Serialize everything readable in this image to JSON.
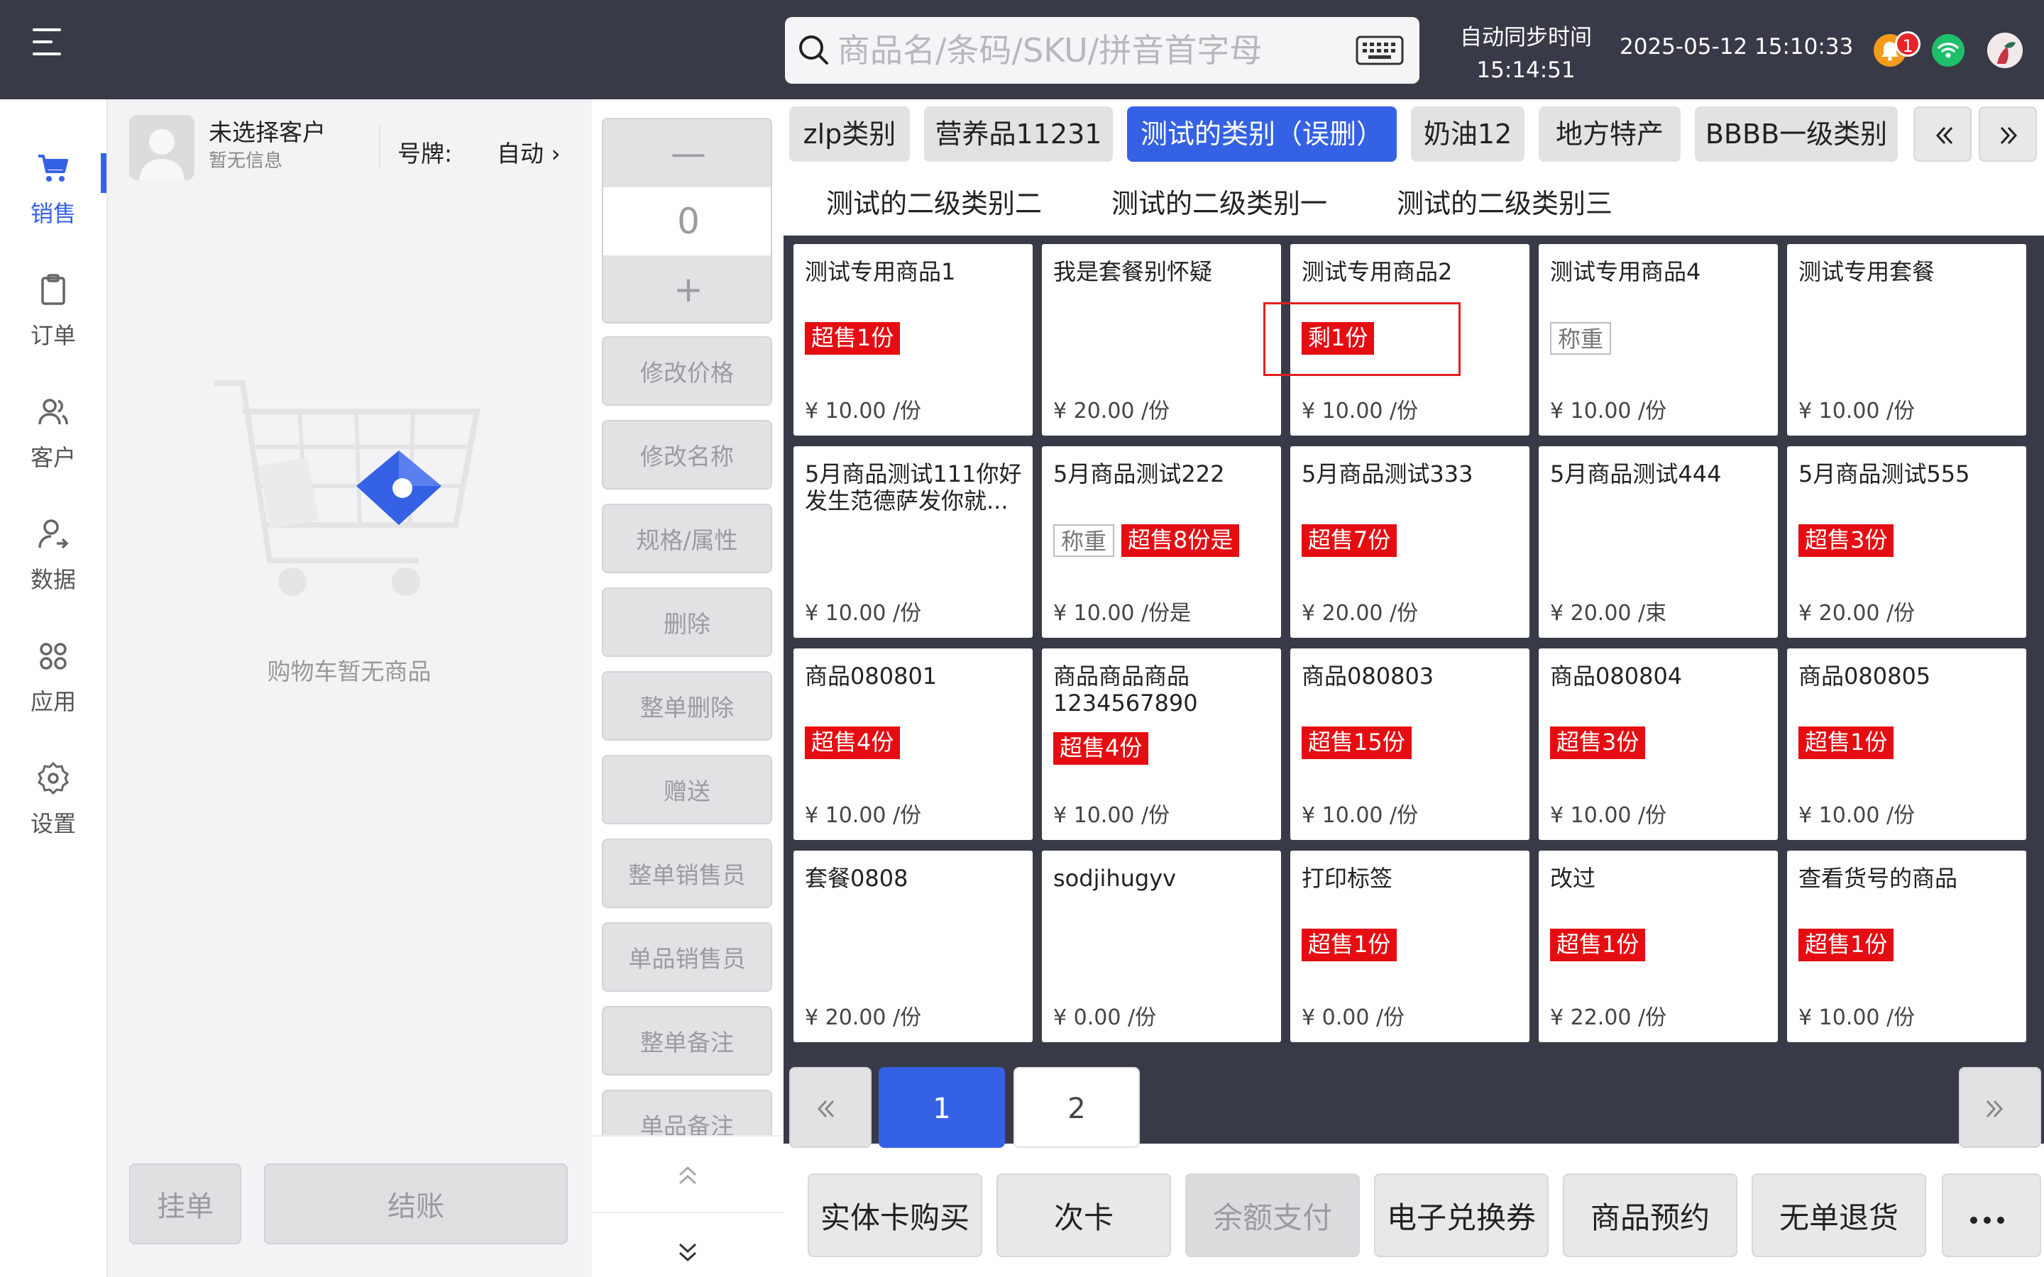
{
  "header": {
    "search_placeholder": "商品名/条码/SKU/拼音首字母",
    "sync_label": "自动同步时间",
    "sync_time": "15:14:51",
    "datetime": "2025-05-12 15:10:33",
    "notification_count": "1"
  },
  "nav": [
    {
      "label": "销售",
      "icon": "cart-icon",
      "active": true
    },
    {
      "label": "订单",
      "icon": "clipboard-icon",
      "active": false
    },
    {
      "label": "客户",
      "icon": "users-icon",
      "active": false
    },
    {
      "label": "数据",
      "icon": "user-data-icon",
      "active": false
    },
    {
      "label": "应用",
      "icon": "apps-icon",
      "active": false
    },
    {
      "label": "设置",
      "icon": "gear-icon",
      "active": false
    }
  ],
  "cart": {
    "customer_name": "未选择客户",
    "customer_info": "暂无信息",
    "plate_label": "号牌:",
    "plate_value": "自动 ›",
    "empty_text": "购物车暂无商品",
    "hold_label": "挂单",
    "checkout_label": "结账"
  },
  "actions": {
    "quantity": "0",
    "minus": "—",
    "plus": "+",
    "buttons": [
      "修改价格",
      "修改名称",
      "规格/属性",
      "删除",
      "整单删除",
      "赠送",
      "整单销售员",
      "单品销售员",
      "整单备注",
      "单品备注"
    ]
  },
  "categories": [
    {
      "label": "zlp类别",
      "active": false
    },
    {
      "label": "营养品11231",
      "active": false
    },
    {
      "label": "测试的类别（误删）",
      "active": true
    },
    {
      "label": "奶油12",
      "active": false
    },
    {
      "label": "地方特产",
      "active": false
    },
    {
      "label": "BBBB一级类别",
      "active": false
    }
  ],
  "subcategories": [
    "测试的二级类别二",
    "测试的二级类别一",
    "测试的二级类别三"
  ],
  "products": [
    {
      "name": "测试专用商品1",
      "tags": [
        {
          "text": "超售1份",
          "style": "red"
        }
      ],
      "price": "¥ 10.00 /份"
    },
    {
      "name": "我是套餐别怀疑",
      "tags": [],
      "price": "¥ 20.00 /份"
    },
    {
      "name": "测试专用商品2",
      "tags": [
        {
          "text": "剩1份",
          "style": "red"
        }
      ],
      "price": "¥ 10.00 /份"
    },
    {
      "name": "测试专用商品4",
      "tags": [
        {
          "text": "称重",
          "style": "gray"
        }
      ],
      "price": "¥ 10.00 /份"
    },
    {
      "name": "测试专用套餐",
      "tags": [],
      "price": "¥ 10.00 /份"
    },
    {
      "name": "5月商品测试111你好发生范德萨发你就...",
      "tags": [],
      "price": "¥ 10.00 /份"
    },
    {
      "name": "5月商品测试222",
      "tags": [
        {
          "text": "称重",
          "style": "gray"
        },
        {
          "text": "超售8份是",
          "style": "red"
        }
      ],
      "price": "¥ 10.00 /份是"
    },
    {
      "name": "5月商品测试333",
      "tags": [
        {
          "text": "超售7份",
          "style": "red"
        }
      ],
      "price": "¥ 20.00 /份"
    },
    {
      "name": "5月商品测试444",
      "tags": [],
      "price": "¥ 20.00 /束"
    },
    {
      "name": "5月商品测试555",
      "tags": [
        {
          "text": "超售3份",
          "style": "red"
        }
      ],
      "price": "¥ 20.00 /份"
    },
    {
      "name": "商品080801",
      "tags": [
        {
          "text": "超售4份",
          "style": "red"
        }
      ],
      "price": "¥ 10.00 /份"
    },
    {
      "name": "商品商品商品1234567890",
      "tags": [
        {
          "text": "超售4份",
          "style": "red"
        }
      ],
      "price": "¥ 10.00 /份"
    },
    {
      "name": "商品080803",
      "tags": [
        {
          "text": "超售15份",
          "style": "red"
        }
      ],
      "price": "¥ 10.00 /份"
    },
    {
      "name": "商品080804",
      "tags": [
        {
          "text": "超售3份",
          "style": "red"
        }
      ],
      "price": "¥ 10.00 /份"
    },
    {
      "name": "商品080805",
      "tags": [
        {
          "text": "超售1份",
          "style": "red"
        }
      ],
      "price": "¥ 10.00 /份"
    },
    {
      "name": "套餐0808",
      "tags": [],
      "price": "¥ 20.00 /份"
    },
    {
      "name": "sodjihugyv",
      "tags": [],
      "price": "¥ 0.00 /份"
    },
    {
      "name": "打印标签",
      "tags": [
        {
          "text": "超售1份",
          "style": "red"
        }
      ],
      "price": "¥ 0.00 /份"
    },
    {
      "name": "改过",
      "tags": [
        {
          "text": "超售1份",
          "style": "red"
        }
      ],
      "price": "¥ 22.00 /份"
    },
    {
      "name": "查看货号的商品",
      "tags": [
        {
          "text": "超售1份",
          "style": "red"
        }
      ],
      "price": "¥ 10.00 /份"
    }
  ],
  "pagination": {
    "pages": [
      "1",
      "2"
    ],
    "current": "1"
  },
  "bottom_actions": [
    {
      "label": "实体卡购买",
      "disabled": false
    },
    {
      "label": "次卡",
      "disabled": false
    },
    {
      "label": "余额支付",
      "disabled": true
    },
    {
      "label": "电子兑换券",
      "disabled": false
    },
    {
      "label": "商品预约",
      "disabled": false
    },
    {
      "label": "无单退货",
      "disabled": false
    }
  ],
  "colors": {
    "accent": "#3562e4",
    "topbar": "#383b47",
    "tag_red": "#e60d12"
  }
}
